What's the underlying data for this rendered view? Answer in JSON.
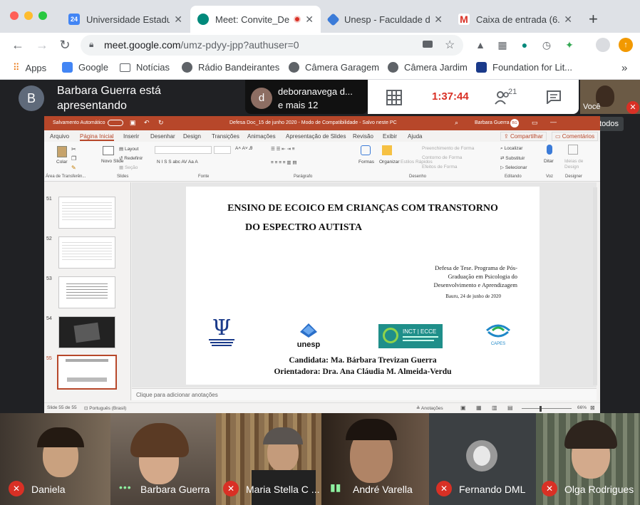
{
  "browser": {
    "tabs": [
      {
        "title": "Universidade Estadu",
        "favicon": "calendar-icon",
        "color": "#4285f4",
        "glyph": "24"
      },
      {
        "title": "Meet: Convite_De",
        "favicon": "meet-icon",
        "color": "#00897b",
        "glyph": ""
      },
      {
        "title": "Unesp - Faculdade d",
        "favicon": "unesp-icon",
        "color": "#3b7bd8",
        "glyph": ""
      },
      {
        "title": "Caixa de entrada (6.",
        "favicon": "gmail-icon",
        "color": "#d93025",
        "glyph": "M"
      }
    ],
    "new_tab": "+",
    "url_host": "meet.google.com",
    "url_path": "/umz-pdyy-jpp?authuser=0",
    "bookmarks": [
      {
        "label": "Apps",
        "icon": "apps-grid-icon",
        "color": "#e8710a"
      },
      {
        "label": "Google",
        "icon": "google-icon",
        "color": "#4285f4"
      },
      {
        "label": "Notícias",
        "icon": "folder-icon",
        "color": "#5f6368"
      },
      {
        "label": "Rádio Bandeirantes",
        "icon": "globe-icon",
        "color": "#5f6368"
      },
      {
        "label": "Câmera Garagem",
        "icon": "globe-icon",
        "color": "#5f6368"
      },
      {
        "label": "Câmera Jardim",
        "icon": "globe-icon",
        "color": "#5f6368"
      },
      {
        "label": "Foundation for Lit...",
        "icon": "foundation-icon",
        "color": "#1a3a8a"
      }
    ],
    "more_bookmarks": "»"
  },
  "meet": {
    "presenter_initial": "B",
    "presenter_text": "Barbara Guerra está apresentando",
    "chat_initial": "d",
    "chat_line1": "deboranavega d...",
    "chat_line2": "e mais 12",
    "timer": "1:37:44",
    "participant_count": "21",
    "self_label": "Você",
    "tooltip": "Chat com todos",
    "accent": "#d93025"
  },
  "ppt": {
    "autosave": "Salvamento Automático",
    "doc_title": "Defesa Doc_15 de junho 2020  -  Modo de Compatibilidade  -  Salvo neste PC",
    "user": "Barbara Guerra",
    "user_initials": "BG",
    "menu": [
      "Arquivo",
      "Página Inicial",
      "Inserir",
      "Desenhar",
      "Design",
      "Transições",
      "Animações",
      "Apresentação de Slides",
      "Revisão",
      "Exibir",
      "Ajuda"
    ],
    "share": "Compartilhar",
    "comments": "Comentários",
    "groups": [
      "Área de Transferên...",
      "Slides",
      "Fonte",
      "Parágrafo",
      "Desenho",
      "Editando",
      "Voz",
      "Designer"
    ],
    "ribbon": {
      "colar": "Colar",
      "novo_slide": "Novo Slide",
      "layout": "Layout",
      "redefinir": "Redefinir",
      "secao": "Seção",
      "formas": "Formas",
      "organizar": "Organizar",
      "estilos": "Estilos Rápidos",
      "preenchimento": "Preenchimento de Forma",
      "contorno": "Contorno de Forma",
      "efeitos": "Efeitos de Forma",
      "localizar": "Localizar",
      "substituir": "Substituir",
      "selecionar": "Selecionar",
      "ditar": "Ditar",
      "ideias": "Ideias de Design"
    },
    "thumbs": [
      "51",
      "52",
      "53",
      "54",
      "55"
    ],
    "slide": {
      "title1": "ENSINO DE ECOICO EM CRIANÇAS COM TRANSTORNO",
      "title2": "DO ESPECTRO AUTISTA",
      "defense": "Defesa de Tese. Programa de Pós-Graduação em Psicologia do Desenvolvimento e Aprendizagem",
      "date": "Bauru, 24 de junho de 2020",
      "logo_unesp": "unesp",
      "logo_incti": "INCT | ECCE",
      "logo_capes": "CAPES",
      "candidata": "Candidata: Ma. Bárbara Trevizan Guerra",
      "orientadora": "Orientadora: Dra. Ana Cláudia M. Almeida-Verdu"
    },
    "notes_placeholder": "Clique para adicionar anotações",
    "status_slide": "Slide 55 de 55",
    "status_lang": "Português (Brasil)",
    "status_notes": "Anotações",
    "zoom": "66%"
  },
  "participants": [
    {
      "name": "Daniela",
      "status": "muted"
    },
    {
      "name": "Barbara Guerra",
      "status": "speaking"
    },
    {
      "name": "Maria Stella C ...",
      "status": "muted"
    },
    {
      "name": "André Varella",
      "status": "speaking"
    },
    {
      "name": "Fernando DML",
      "status": "muted"
    },
    {
      "name": "Olga Rodrigues",
      "status": "muted"
    }
  ]
}
